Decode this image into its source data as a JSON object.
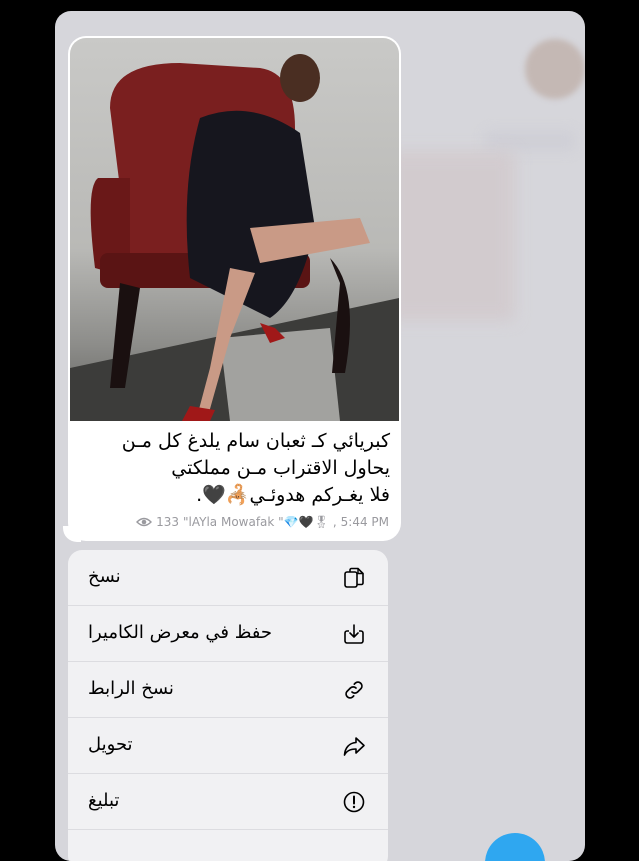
{
  "message": {
    "caption_lines": [
      "كبريائي كـ ثعبان سام يلدغ كل مـن",
      "يحاول الاقتراب مـن مملكتي",
      "فلا يغـركم هدوئـي🦂🖤."
    ],
    "views": "133",
    "author": "\"lAYla Mowafak \"💎🖤🎖",
    "time": "5:44 PM"
  },
  "context_menu": {
    "items": [
      {
        "label": "نسخ",
        "icon": "copy-icon"
      },
      {
        "label": "حفظ في معرض الكاميرا",
        "icon": "save-download-icon"
      },
      {
        "label": "نسخ الرابط",
        "icon": "link-icon"
      },
      {
        "label": "تحويل",
        "icon": "forward-icon"
      },
      {
        "label": "تبليغ",
        "icon": "report-icon"
      }
    ]
  },
  "colors": {
    "backdrop": "#d6d6db",
    "bubble": "#ffffff",
    "menu": "#f1f1f3",
    "meta_text": "#9a9a9f",
    "fab": "#2fa7f0"
  }
}
